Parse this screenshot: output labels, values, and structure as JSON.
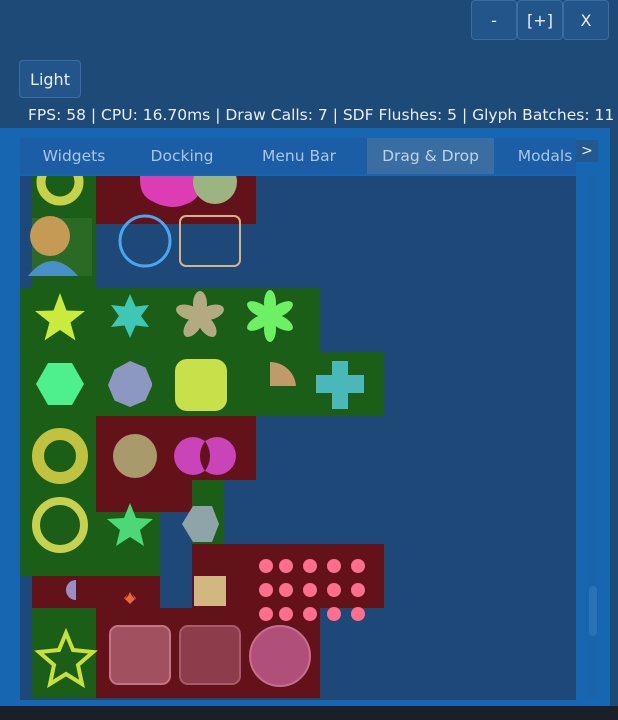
{
  "window": {
    "minimize_label": "-",
    "maximize_label": "[+]",
    "close_label": "X"
  },
  "toolbar": {
    "theme_button_label": "Light"
  },
  "stats": {
    "text": "FPS: 58  |  CPU: 16.70ms  |  Draw Calls: 7  |  SDF Flushes: 5  |  Glyph Batches: 11"
  },
  "tabs": [
    {
      "label": "Widgets",
      "active": false
    },
    {
      "label": "Docking",
      "active": false
    },
    {
      "label": "Menu Bar",
      "active": false
    },
    {
      "label": "Drag & Drop",
      "active": true
    },
    {
      "label": "Modals",
      "active": false
    }
  ],
  "tab_overflow_label": ">",
  "colors": {
    "window_bg": "#1e4a78",
    "panel_bg": "#1766b2",
    "content_bg": "#1d4878",
    "cell_green": "#1b5e18",
    "cell_red": "#64121a",
    "accent_blue": "#3d8fe0"
  }
}
